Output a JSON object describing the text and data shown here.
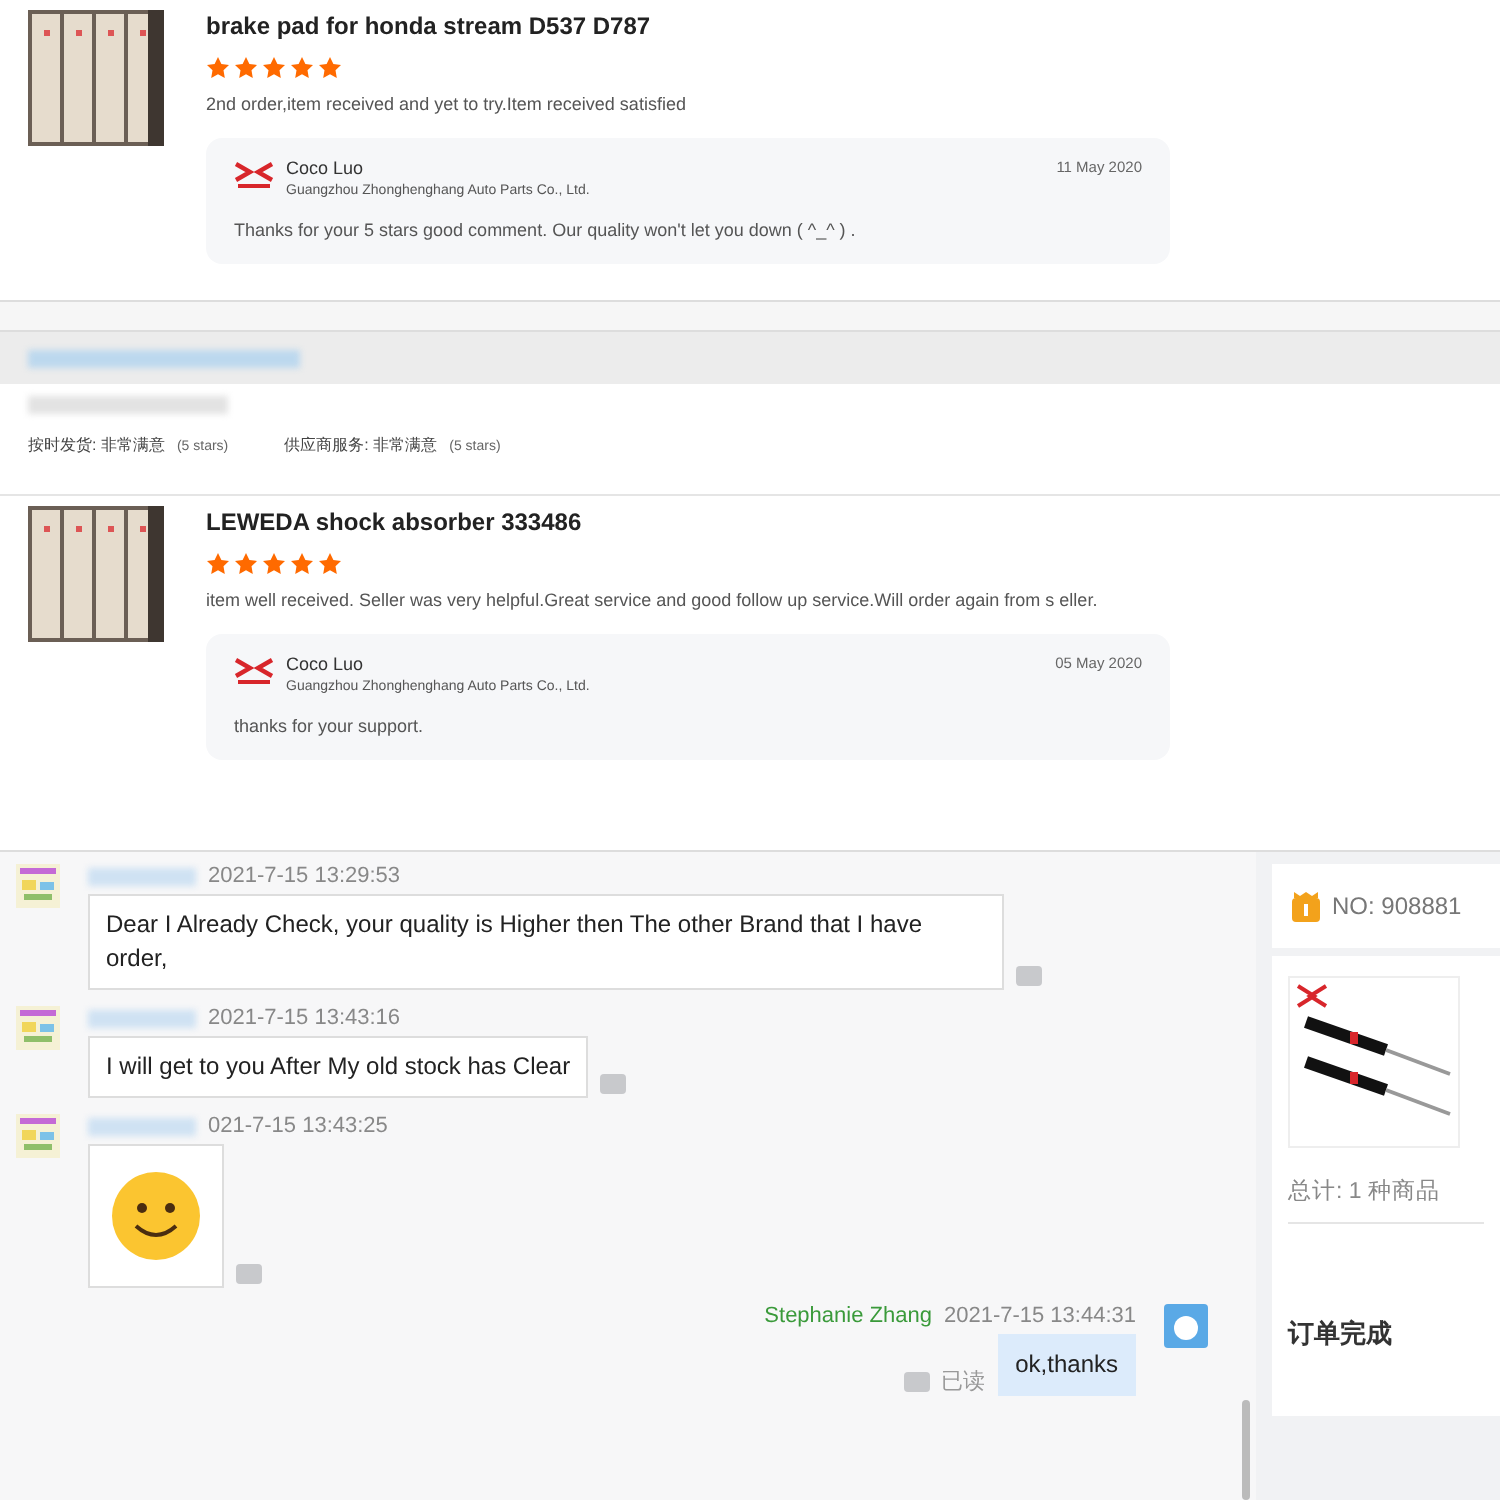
{
  "reviews": [
    {
      "product": "brake pad for honda stream D537 D787",
      "stars": 5,
      "comment": "2nd order,item received and yet to try.Item received satisfied",
      "reply": {
        "name": "Coco Luo",
        "company": "Guangzhou Zhonghenghang Auto Parts Co., Ltd.",
        "date": "11 May 2020",
        "text": "Thanks for your 5 stars good comment. Our quality won't let you down ( ^_^ ) ."
      }
    },
    {
      "product": "LEWEDA shock absorber 333486",
      "stars": 5,
      "comment": "item well received. Seller was very helpful.Great service and good follow up service.Will order again from s eller.",
      "reply": {
        "name": "Coco Luo",
        "company": "Guangzhou Zhonghenghang Auto Parts Co., Ltd.",
        "date": "05 May 2020",
        "text": "thanks for your support."
      }
    }
  ],
  "seller_ratings": [
    {
      "label": "按时发货:",
      "value": "非常满意",
      "note": "(5 stars)"
    },
    {
      "label": "供应商服务:",
      "value": "非常满意",
      "note": "(5 stars)"
    }
  ],
  "chat": {
    "messages": [
      {
        "kind": "text",
        "outgoing": false,
        "time": "2021-7-15 13:29:53",
        "text": "Dear I Already Check, your quality is Higher then The other Brand that I have  order,"
      },
      {
        "kind": "text",
        "outgoing": false,
        "time": "2021-7-15 13:43:16",
        "text": "I will get to you After My old stock has Clear"
      },
      {
        "kind": "sticker",
        "outgoing": false,
        "time": "021-7-15 13:43:25"
      },
      {
        "kind": "text",
        "outgoing": true,
        "sender": "Stephanie Zhang",
        "time": "2021-7-15 13:44:31",
        "text": "ok,thanks",
        "status": "已读"
      }
    ]
  },
  "order": {
    "number": "NO: 908881",
    "total": "总计: 1 种商品",
    "status": "订单完成"
  }
}
